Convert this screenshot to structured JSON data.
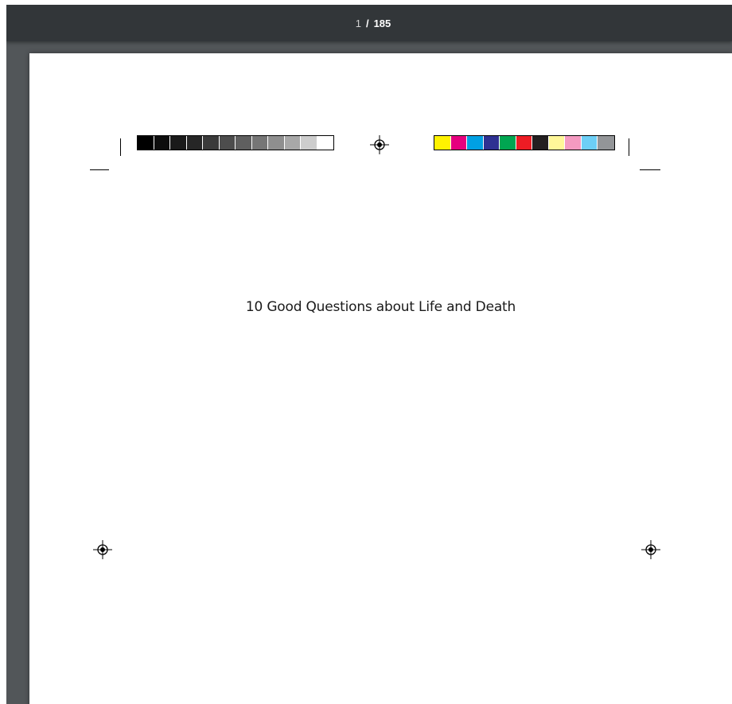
{
  "toolbar": {
    "current_page": "1",
    "separator": "/",
    "total_pages": "185"
  },
  "page": {
    "title": "10 Good Questions about Life and Death"
  },
  "color_bars": {
    "grayscale": [
      "#000000",
      "#0d0d0d",
      "#1a1a1a",
      "#262626",
      "#3a3a3a",
      "#4d4d4d",
      "#5f5f5f",
      "#767676",
      "#8f8f8f",
      "#a8a8a8",
      "#cdcdcd",
      "#ffffff"
    ],
    "process": [
      "#fff200",
      "#e6007e",
      "#00a0e3",
      "#2e3192",
      "#00a651",
      "#ed1c24",
      "#231f20",
      "#fff799",
      "#f49ac1",
      "#6dcff6",
      "#939598"
    ]
  }
}
